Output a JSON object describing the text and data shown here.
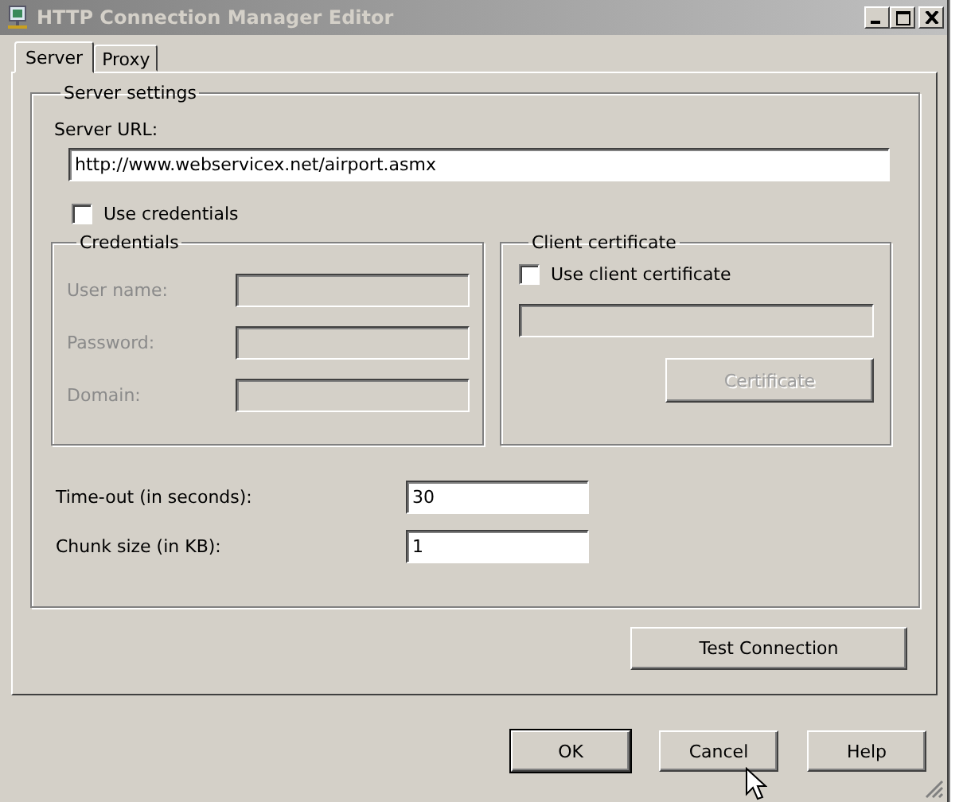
{
  "window": {
    "title": "HTTP Connection Manager Editor"
  },
  "tabs": [
    {
      "label": "Server",
      "selected": true
    },
    {
      "label": "Proxy",
      "selected": false
    }
  ],
  "server_settings": {
    "title": "Server settings",
    "server_url": {
      "label": "Server URL:",
      "value": "http://www.webservicex.net/airport.asmx"
    },
    "use_credentials": {
      "label": "Use credentials",
      "checked": false
    },
    "credentials": {
      "title": "Credentials",
      "disabled": true,
      "fields": [
        {
          "label": "User name:"
        },
        {
          "label": "Password:"
        },
        {
          "label": "Domain:"
        }
      ]
    },
    "client_certificate": {
      "title": "Client certificate",
      "use_client_certificate": {
        "label": "Use client certificate",
        "checked": false
      },
      "path_disabled": true,
      "button": {
        "label": "Certificate",
        "disabled": true
      }
    },
    "timeout": {
      "label": "Time-out (in seconds):",
      "value": "30"
    },
    "chunk_size": {
      "label": "Chunk size (in KB):",
      "value": "1"
    }
  },
  "test_connection_button": {
    "label": "Test Connection"
  },
  "buttons": [
    {
      "label": "OK",
      "default": true
    },
    {
      "label": "Cancel",
      "default": false
    },
    {
      "label": "Help",
      "default": false
    }
  ]
}
